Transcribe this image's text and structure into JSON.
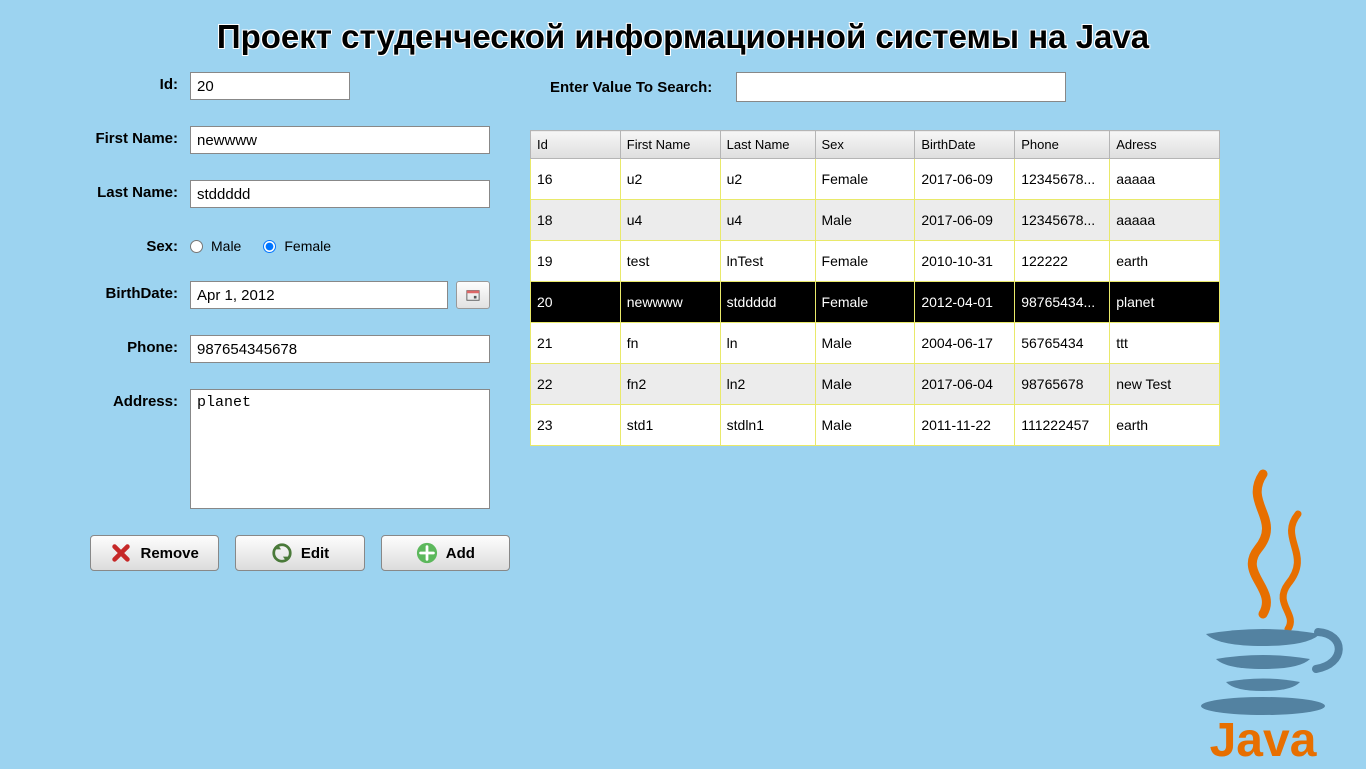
{
  "page_title": "Проект студенческой информационной системы на Java",
  "form": {
    "labels": {
      "id": "Id:",
      "first_name": "First Name:",
      "last_name": "Last Name:",
      "sex": "Sex:",
      "birthdate": "BirthDate:",
      "phone": "Phone:",
      "address": "Address:"
    },
    "values": {
      "id": "20",
      "first_name": "newwww",
      "last_name": "stddddd",
      "sex": "Female",
      "birthdate": "Apr 1, 2012",
      "phone": "987654345678",
      "address": "planet"
    },
    "sex_options": {
      "male": "Male",
      "female": "Female"
    }
  },
  "buttons": {
    "remove": "Remove",
    "edit": "Edit",
    "add": "Add"
  },
  "search": {
    "label": "Enter Value To Search:",
    "value": ""
  },
  "table": {
    "selected_id": "20",
    "headers": [
      "Id",
      "First Name",
      "Last Name",
      "Sex",
      "BirthDate",
      "Phone",
      "Adress"
    ],
    "rows": [
      {
        "id": "16",
        "first_name": "u2",
        "last_name": "u2",
        "sex": "Female",
        "birthdate": "2017-06-09",
        "phone": "12345678...",
        "address": "aaaaa"
      },
      {
        "id": "18",
        "first_name": "u4",
        "last_name": "u4",
        "sex": "Male",
        "birthdate": "2017-06-09",
        "phone": "12345678...",
        "address": "aaaaa"
      },
      {
        "id": "19",
        "first_name": "test",
        "last_name": "lnTest",
        "sex": "Female",
        "birthdate": "2010-10-31",
        "phone": "122222",
        "address": "earth"
      },
      {
        "id": "20",
        "first_name": "newwww",
        "last_name": "stddddd",
        "sex": "Female",
        "birthdate": "2012-04-01",
        "phone": "98765434...",
        "address": "planet"
      },
      {
        "id": "21",
        "first_name": "fn",
        "last_name": "ln",
        "sex": "Male",
        "birthdate": "2004-06-17",
        "phone": "56765434",
        "address": "ttt"
      },
      {
        "id": "22",
        "first_name": "fn2",
        "last_name": "ln2",
        "sex": "Male",
        "birthdate": "2017-06-04",
        "phone": "98765678",
        "address": "new Test"
      },
      {
        "id": "23",
        "first_name": "std1",
        "last_name": "stdln1",
        "sex": "Male",
        "birthdate": "2011-11-22",
        "phone": "111222457",
        "address": "earth"
      }
    ]
  },
  "logo_text": "Java"
}
